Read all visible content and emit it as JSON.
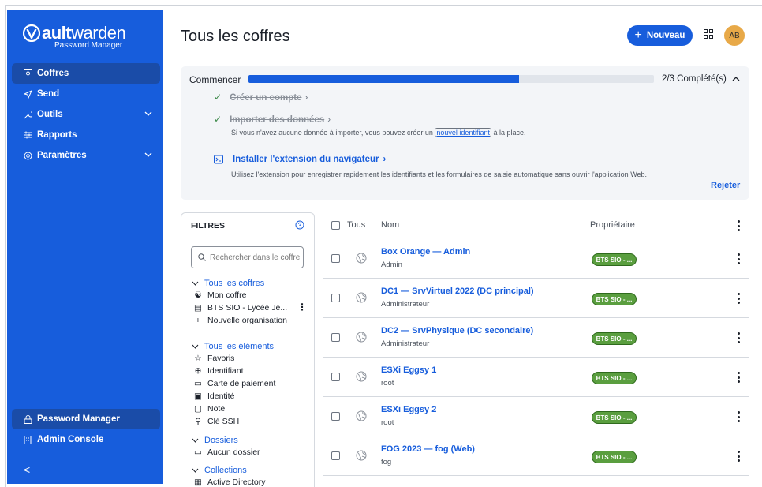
{
  "brand": {
    "name_bold": "ault",
    "name_light": "warden",
    "tagline": "Password Manager"
  },
  "sidebar": {
    "items": [
      {
        "label": "Coffres",
        "icon": "vault-icon",
        "active": true
      },
      {
        "label": "Send",
        "icon": "send-icon",
        "active": false
      },
      {
        "label": "Outils",
        "icon": "tools-icon",
        "active": false,
        "expandable": true
      },
      {
        "label": "Rapports",
        "icon": "reports-icon",
        "active": false
      },
      {
        "label": "Paramètres",
        "icon": "gear-icon",
        "active": false,
        "expandable": true
      }
    ],
    "bottom": [
      {
        "label": "Password Manager",
        "icon": "lock-icon",
        "active": true
      },
      {
        "label": "Admin Console",
        "icon": "building-icon",
        "active": false
      }
    ],
    "collapse_glyph": "<"
  },
  "header": {
    "title": "Tous les coffres",
    "new_label": "Nouveau",
    "avatar": "AB"
  },
  "getting_started": {
    "title": "Commencer",
    "progress": 0.667,
    "progress_text": "2/3 Complété(s)",
    "steps": [
      {
        "label": "Créer un compte",
        "done": true
      },
      {
        "label": "Importer des données",
        "done": true
      }
    ],
    "import_note_before": "Si vous n'avez aucune donnée à importer, vous pouvez créer un",
    "import_note_link": "nouvel identifiant",
    "import_note_after": "à la place.",
    "extension_label": "Installer l'extension du navigateur",
    "extension_note": "Utilisez l'extension pour enregistrer rapidement les identifiants et les formulaires de saisie automatique sans ouvrir l'application Web.",
    "dismiss": "Rejeter"
  },
  "filters": {
    "title": "FILTRES",
    "search_placeholder": "Rechercher dans le coffre",
    "vaults_group": "Tous les coffres",
    "vaults": [
      "Mon coffre",
      "BTS SIO - Lycée Je...",
      "Nouvelle organisation"
    ],
    "items_group": "Tous les éléments",
    "items": [
      "Favoris",
      "Identifiant",
      "Carte de paiement",
      "Identité",
      "Note",
      "Clé SSH"
    ],
    "folders_group": "Dossiers",
    "folders": [
      "Aucun dossier"
    ],
    "collections_group": "Collections",
    "collections": [
      "Active Directory"
    ]
  },
  "table": {
    "headers": {
      "all": "Tous",
      "name": "Nom",
      "owner": "Propriétaire"
    },
    "rows": [
      {
        "name": "Box Orange — Admin",
        "sub": "Admin",
        "owner": "BTS SIO - ..."
      },
      {
        "name": "DC1 — SrvVirtuel 2022 (DC principal)",
        "sub": "Administrateur",
        "owner": "BTS SIO - ..."
      },
      {
        "name": "DC2 — SrvPhysique (DC secondaire)",
        "sub": "Administrateur",
        "owner": "BTS SIO - ..."
      },
      {
        "name": "ESXi Eggsy 1",
        "sub": "root",
        "owner": "BTS SIO - ..."
      },
      {
        "name": "ESXi Eggsy 2",
        "sub": "root",
        "owner": "BTS SIO - ..."
      },
      {
        "name": "FOG 2023 — fog (Web)",
        "sub": "fog",
        "owner": "BTS SIO - ..."
      }
    ]
  },
  "colors": {
    "brand": "#175ddc",
    "sidebar_active": "#1a4ca8",
    "badge": "#5a9e3f",
    "avatar": "#e8a948"
  }
}
